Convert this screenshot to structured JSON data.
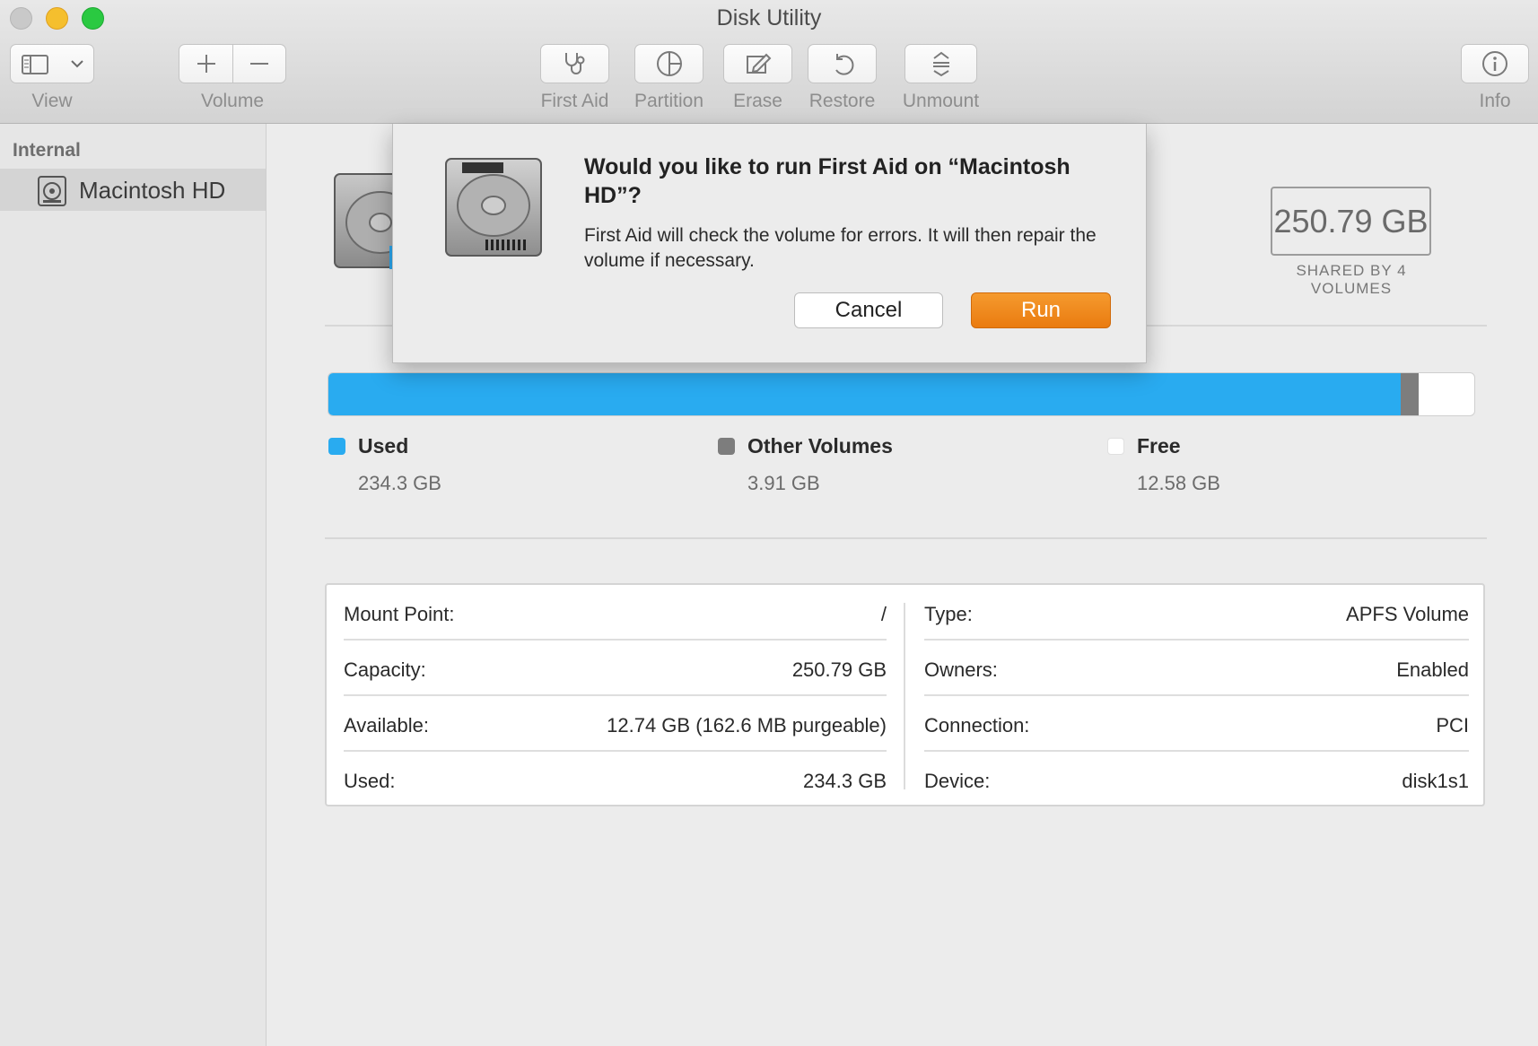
{
  "window": {
    "title": "Disk Utility"
  },
  "toolbar": {
    "view_label": "View",
    "volume_label": "Volume",
    "first_aid_label": "First Aid",
    "partition_label": "Partition",
    "erase_label": "Erase",
    "restore_label": "Restore",
    "unmount_label": "Unmount",
    "info_label": "Info"
  },
  "sidebar": {
    "section_header": "Internal",
    "items": [
      {
        "label": "Macintosh HD",
        "icon": "hard-drive-icon",
        "selected": true
      }
    ]
  },
  "volume": {
    "capacity_display": "250.79 GB",
    "capacity_subtitle": "SHARED BY 4 VOLUMES"
  },
  "usage": {
    "used_fraction": 0.9355,
    "other_fraction": 0.0156,
    "free_fraction": 0.0489,
    "legend": [
      {
        "name": "Used",
        "value": "234.3 GB",
        "color": "#29abf0"
      },
      {
        "name": "Other Volumes",
        "value": "3.91 GB",
        "color": "#7d7d7d"
      },
      {
        "name": "Free",
        "value": "12.58 GB",
        "color": "#ffffff"
      }
    ]
  },
  "info": {
    "left": [
      {
        "key": "Mount Point:",
        "value": "/"
      },
      {
        "key": "Capacity:",
        "value": "250.79 GB"
      },
      {
        "key": "Available:",
        "value": "12.74 GB (162.6 MB purgeable)"
      },
      {
        "key": "Used:",
        "value": "234.3 GB"
      }
    ],
    "right": [
      {
        "key": "Type:",
        "value": "APFS Volume"
      },
      {
        "key": "Owners:",
        "value": "Enabled"
      },
      {
        "key": "Connection:",
        "value": "PCI"
      },
      {
        "key": "Device:",
        "value": "disk1s1"
      }
    ]
  },
  "dialog": {
    "title": "Would you like to run First Aid on “Macintosh HD”?",
    "message": "First Aid will check the volume for errors. It will then repair the volume if necessary.",
    "cancel_label": "Cancel",
    "run_label": "Run",
    "accent_color": "#ea7b10"
  }
}
